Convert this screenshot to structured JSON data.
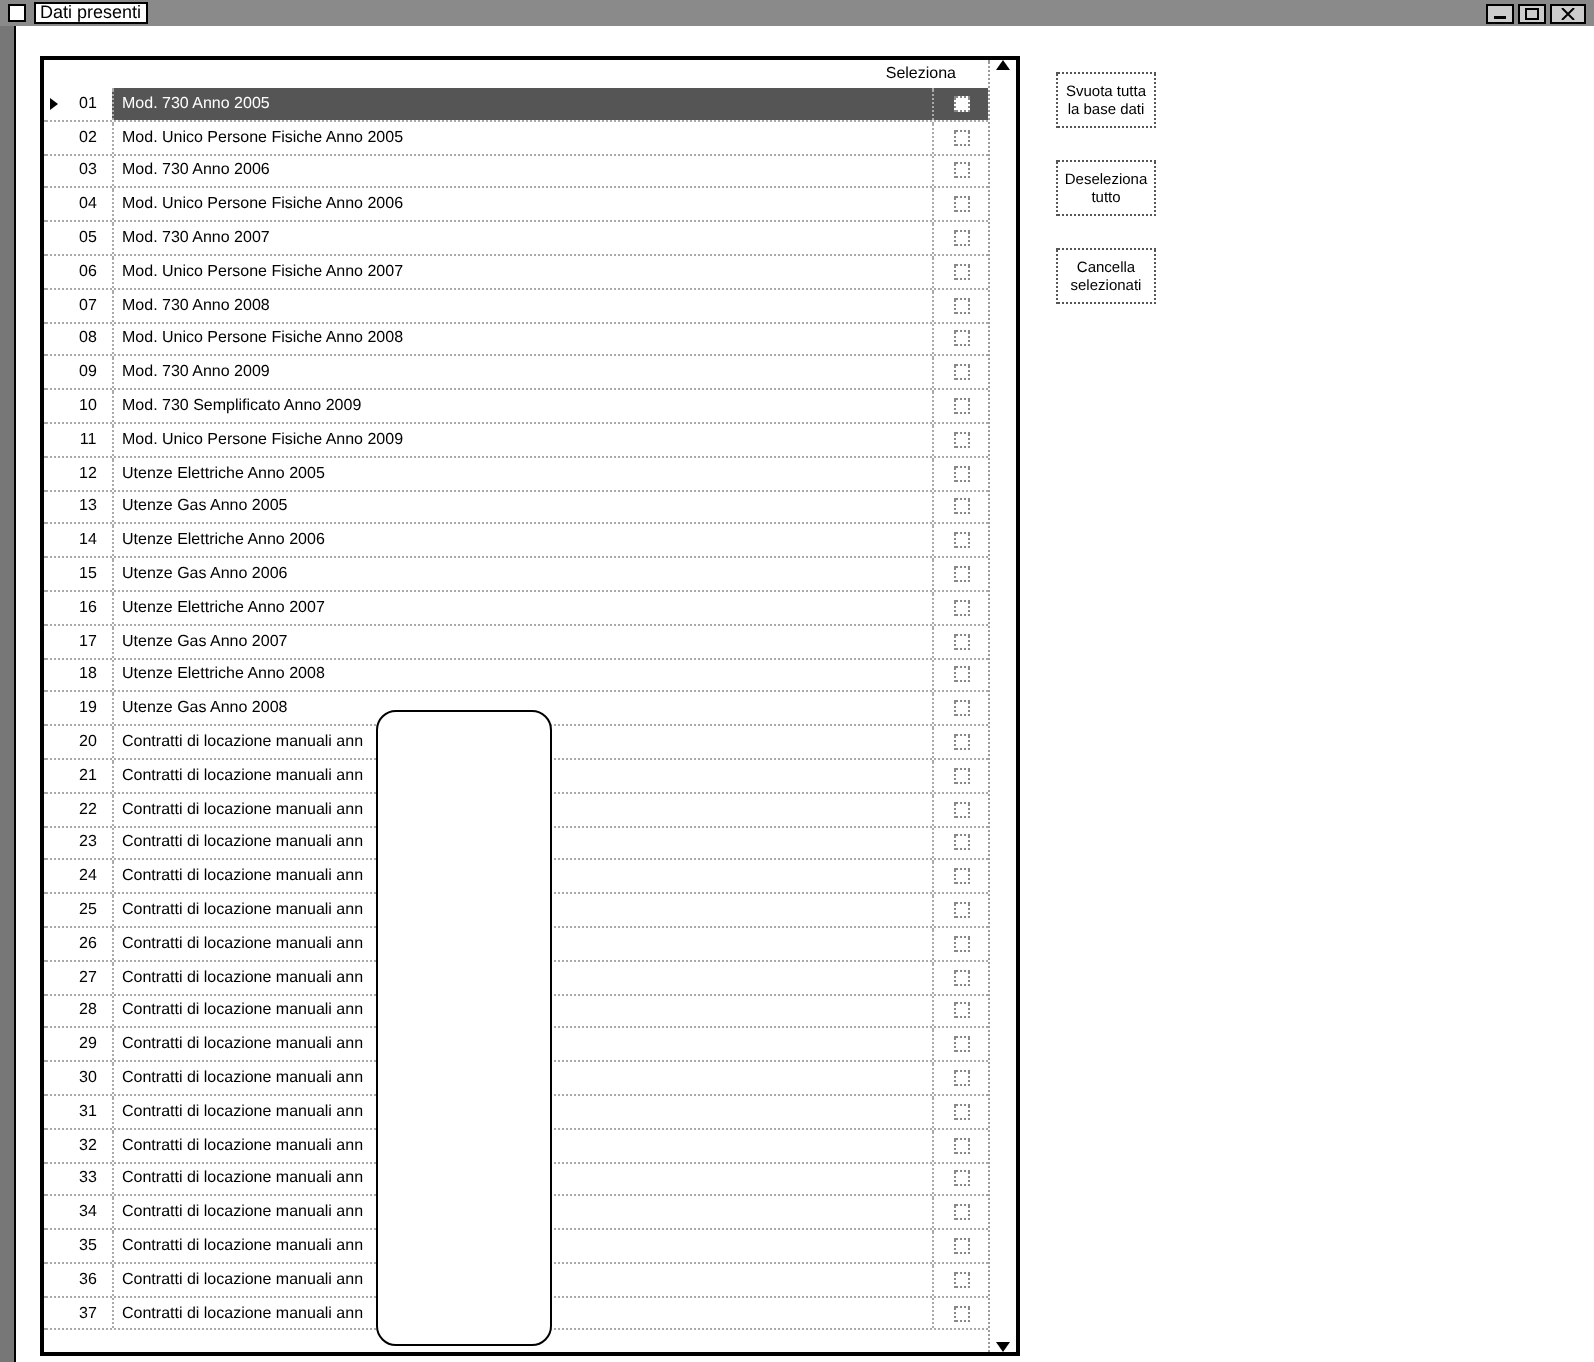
{
  "window": {
    "title": "Dati presenti"
  },
  "table": {
    "columns": [
      "Seleziona"
    ],
    "rows": [
      {
        "number": "01",
        "text": "Mod. 730 Anno 2005",
        "selected": true,
        "checked": false
      },
      {
        "number": "02",
        "text": "Mod. Unico Persone Fisiche Anno 2005",
        "selected": false,
        "checked": false
      },
      {
        "number": "03",
        "text": "Mod. 730 Anno 2006",
        "selected": false,
        "checked": false
      },
      {
        "number": "04",
        "text": "Mod. Unico Persone Fisiche Anno 2006",
        "selected": false,
        "checked": false
      },
      {
        "number": "05",
        "text": "Mod. 730 Anno 2007",
        "selected": false,
        "checked": false
      },
      {
        "number": "06",
        "text": "Mod. Unico Persone Fisiche Anno 2007",
        "selected": false,
        "checked": false
      },
      {
        "number": "07",
        "text": "Mod. 730 Anno 2008",
        "selected": false,
        "checked": false
      },
      {
        "number": "08",
        "text": "Mod. Unico Persone Fisiche Anno 2008",
        "selected": false,
        "checked": false
      },
      {
        "number": "09",
        "text": "Mod. 730 Anno 2009",
        "selected": false,
        "checked": false
      },
      {
        "number": "10",
        "text": "Mod. 730 Semplificato Anno 2009",
        "selected": false,
        "checked": false
      },
      {
        "number": "11",
        "text": "Mod. Unico Persone Fisiche Anno 2009",
        "selected": false,
        "checked": false
      },
      {
        "number": "12",
        "text": "Utenze Elettriche Anno 2005",
        "selected": false,
        "checked": false
      },
      {
        "number": "13",
        "text": "Utenze Gas Anno 2005",
        "selected": false,
        "checked": false
      },
      {
        "number": "14",
        "text": "Utenze Elettriche Anno 2006",
        "selected": false,
        "checked": false
      },
      {
        "number": "15",
        "text": "Utenze Gas Anno 2006",
        "selected": false,
        "checked": false
      },
      {
        "number": "16",
        "text": "Utenze Elettriche Anno 2007",
        "selected": false,
        "checked": false
      },
      {
        "number": "17",
        "text": "Utenze Gas Anno 2007",
        "selected": false,
        "checked": false
      },
      {
        "number": "18",
        "text": "Utenze Elettriche Anno 2008",
        "selected": false,
        "checked": false
      },
      {
        "number": "19",
        "text": "Utenze Gas Anno 2008",
        "selected": false,
        "checked": false
      },
      {
        "number": "20",
        "text": "Contratti di locazione manuali ann",
        "selected": false,
        "checked": false
      },
      {
        "number": "21",
        "text": "Contratti di locazione manuali ann",
        "selected": false,
        "checked": false
      },
      {
        "number": "22",
        "text": "Contratti di locazione manuali ann",
        "selected": false,
        "checked": false
      },
      {
        "number": "23",
        "text": "Contratti di locazione manuali ann",
        "selected": false,
        "checked": false
      },
      {
        "number": "24",
        "text": "Contratti di locazione manuali ann",
        "selected": false,
        "checked": false
      },
      {
        "number": "25",
        "text": "Contratti di locazione manuali ann",
        "selected": false,
        "checked": false
      },
      {
        "number": "26",
        "text": "Contratti di locazione manuali ann",
        "selected": false,
        "checked": false
      },
      {
        "number": "27",
        "text": "Contratti di locazione manuali ann",
        "selected": false,
        "checked": false
      },
      {
        "number": "28",
        "text": "Contratti di locazione manuali ann",
        "selected": false,
        "checked": false
      },
      {
        "number": "29",
        "text": "Contratti di locazione manuali ann",
        "selected": false,
        "checked": false
      },
      {
        "number": "30",
        "text": "Contratti di locazione manuali ann",
        "selected": false,
        "checked": false
      },
      {
        "number": "31",
        "text": "Contratti di locazione manuali ann",
        "selected": false,
        "checked": false
      },
      {
        "number": "32",
        "text": "Contratti di locazione manuali ann",
        "selected": false,
        "checked": false
      },
      {
        "number": "33",
        "text": "Contratti di locazione manuali ann",
        "selected": false,
        "checked": false
      },
      {
        "number": "34",
        "text": "Contratti di locazione manuali ann",
        "selected": false,
        "checked": false
      },
      {
        "number": "35",
        "text": "Contratti di locazione manuali ann",
        "selected": false,
        "checked": false
      },
      {
        "number": "36",
        "text": "Contratti di locazione manuali ann",
        "selected": false,
        "checked": false
      },
      {
        "number": "37",
        "text": "Contratti di locazione manuali ann",
        "selected": false,
        "checked": false
      }
    ]
  },
  "buttons": [
    "Svuota tutta la base dati",
    "Deseleziona tutto",
    "Cancella selezionati"
  ]
}
